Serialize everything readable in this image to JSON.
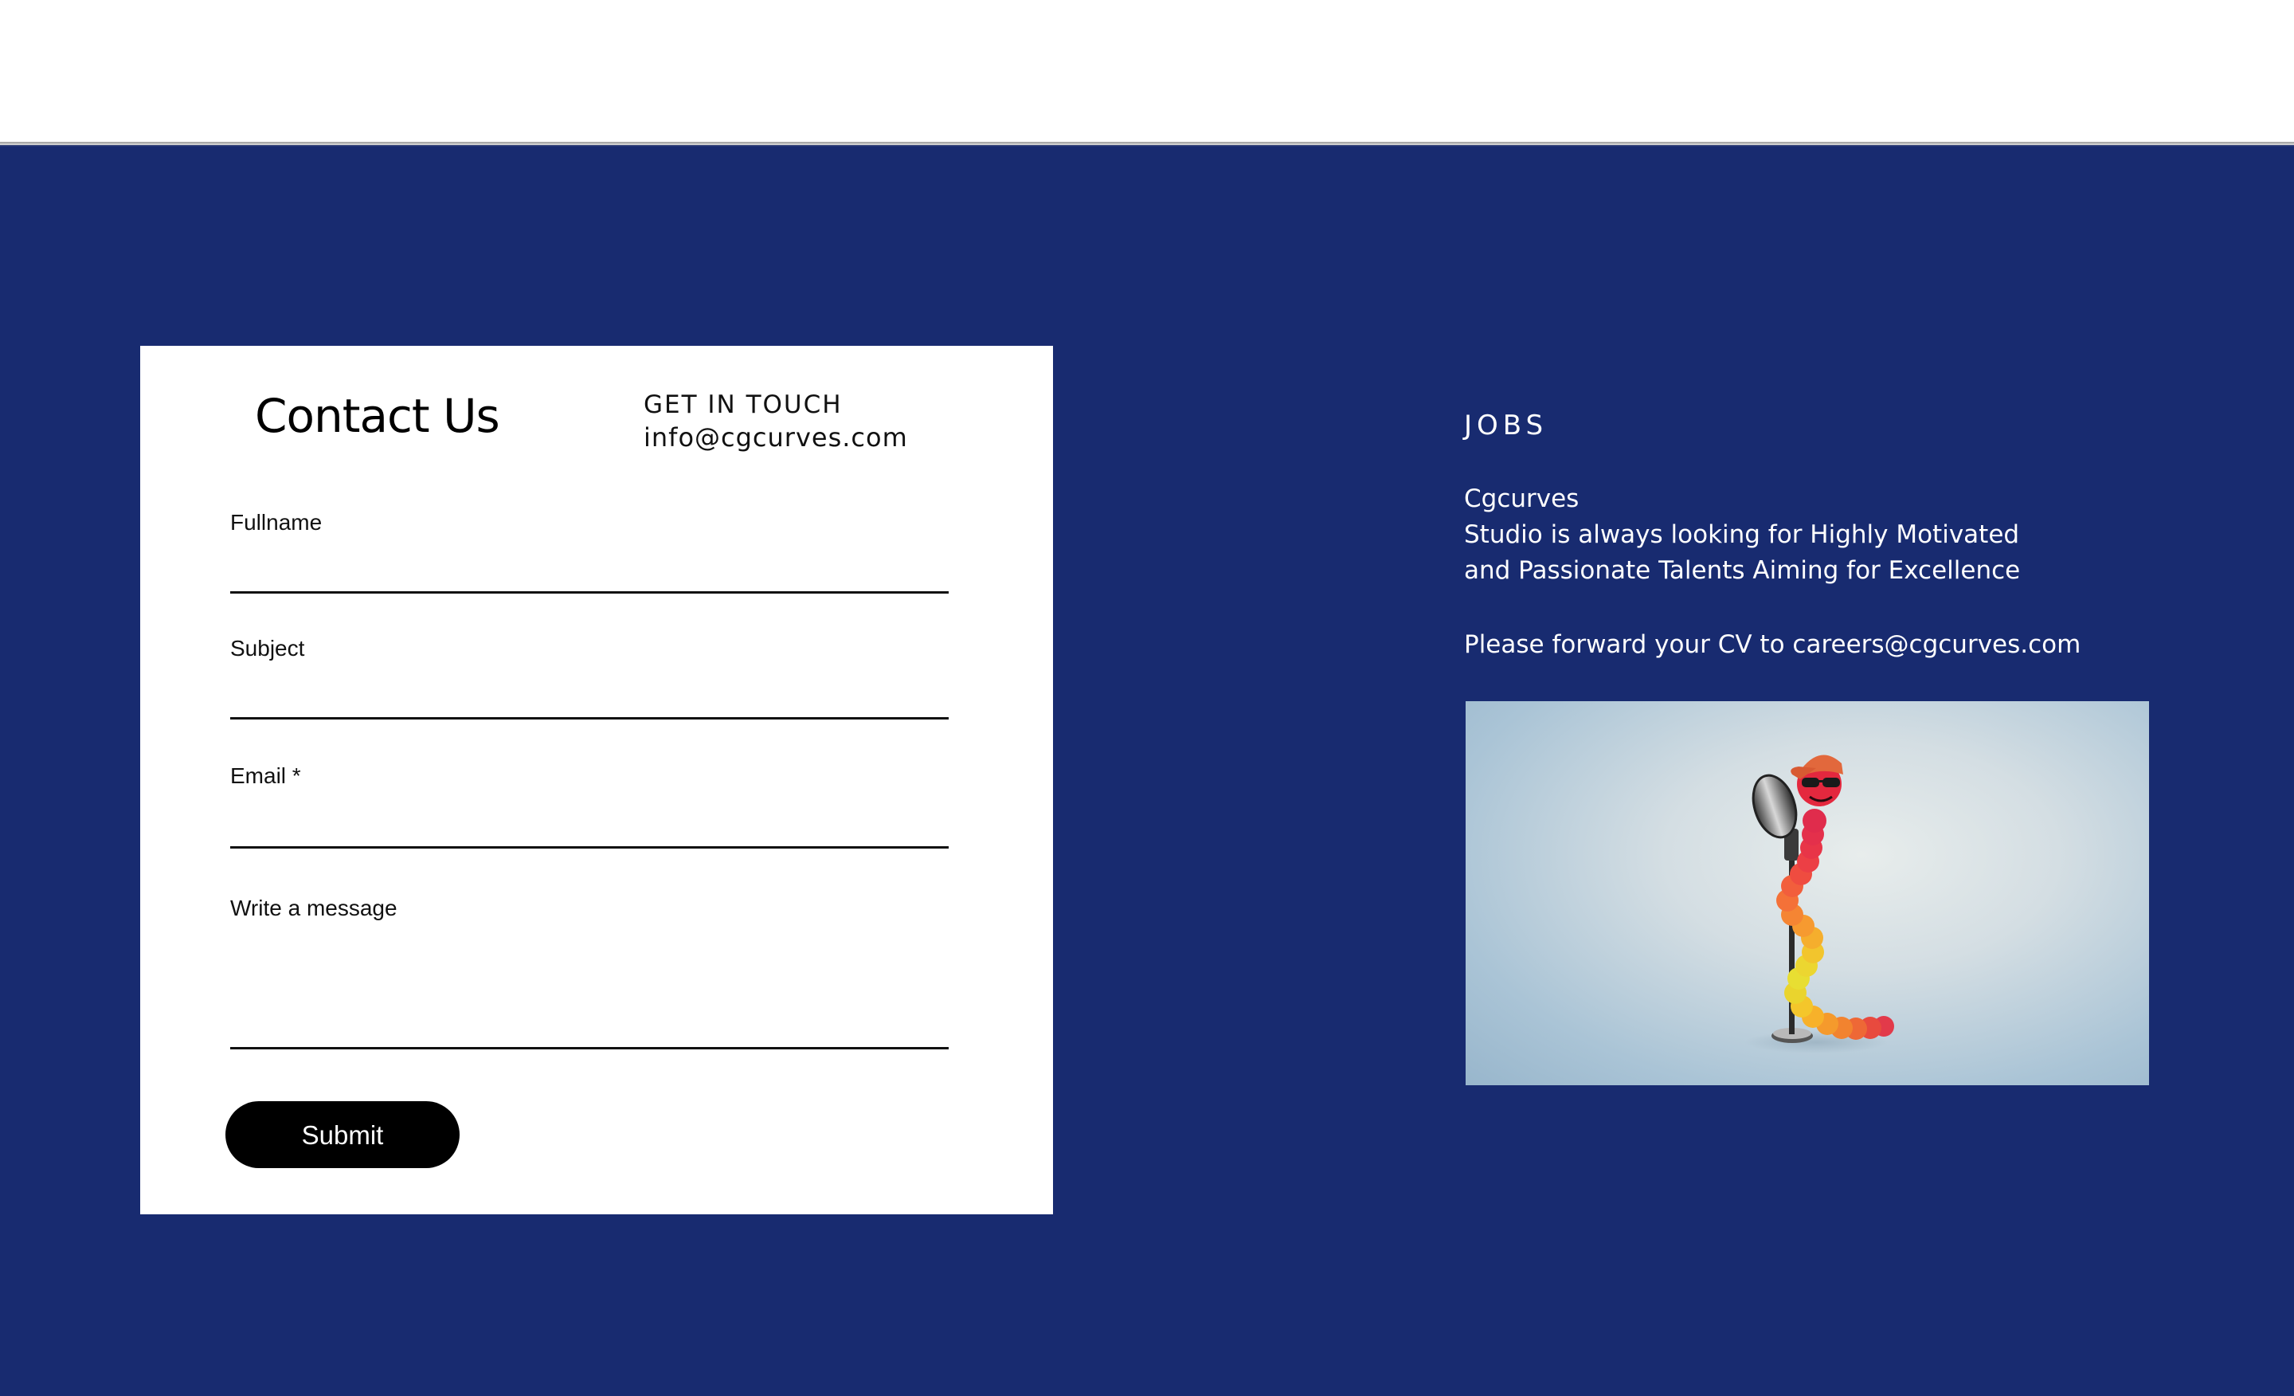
{
  "contact": {
    "title": "Contact Us",
    "get_in_touch_heading": "GET IN TOUCH",
    "email": "info@cgcurves.com",
    "fields": {
      "fullname": "Fullname",
      "subject": "Subject",
      "email": "Email *",
      "message": "Write a message"
    },
    "submit_label": "Submit"
  },
  "jobs": {
    "heading": "JOBS",
    "lines": [
      "Cgcurves",
      "Studio is always looking for Highly Motivated",
      "and Passionate Talents Aiming for Excellence",
      "Please forward your CV to careers@cgcurves.com"
    ],
    "image_icon": "caterpillar-microphone-illustration"
  },
  "colors": {
    "background": "#182b70",
    "card": "#ffffff",
    "button": "#000000"
  }
}
